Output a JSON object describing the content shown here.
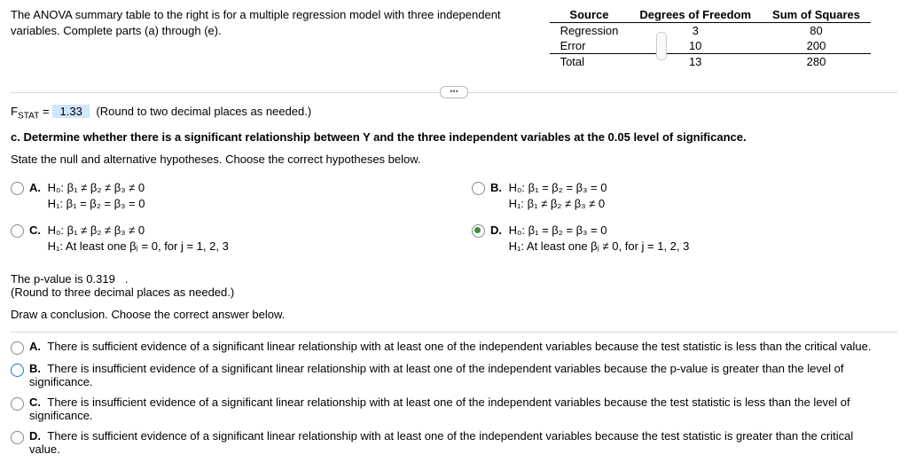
{
  "intro": "The ANOVA summary table to the right is for a multiple regression model with three independent variables. Complete parts (a) through (e).",
  "anova": {
    "headers": {
      "source": "Source",
      "df": "Degrees of Freedom",
      "ss": "Sum of Squares"
    },
    "rows": {
      "regression": {
        "label": "Regression",
        "df": "3",
        "ss": "80"
      },
      "error": {
        "label": "Error",
        "df": "10",
        "ss": "200"
      },
      "total": {
        "label": "Total",
        "df": "13",
        "ss": "280"
      }
    }
  },
  "fstat": {
    "prefix": "F",
    "sublabel": "STAT",
    "equals": " = ",
    "value": "1.33",
    "hint": "(Round to two decimal places as needed.)"
  },
  "partC": {
    "prompt": "c. Determine whether there is a significant relationship between Y and the three independent variables at the 0.05 level of significance.",
    "state": "State the null and alternative hypotheses. Choose the correct hypotheses below."
  },
  "hyp": {
    "A": {
      "lead": "A.",
      "h0": "H₀: β₁ ≠ β₂ ≠ β₃ ≠ 0",
      "h1": "H₁: β₁ = β₂ = β₃ = 0"
    },
    "B": {
      "lead": "B.",
      "h0": "H₀: β₁ = β₂ = β₃ = 0",
      "h1": "H₁: β₁ ≠ β₂ ≠ β₃ ≠ 0"
    },
    "C": {
      "lead": "C.",
      "h0": "H₀: β₁ ≠ β₂ ≠ β₃ ≠ 0",
      "h1": "H₁: At least one βⱼ = 0, for j = 1, 2, 3"
    },
    "D": {
      "lead": "D.",
      "h0": "H₀: β₁ = β₂ = β₃ = 0",
      "h1": "H₁: At least one βⱼ ≠ 0, for j = 1, 2, 3"
    }
  },
  "pval": {
    "prefix": "The p-value is ",
    "value": "0.319",
    "suffix": " .",
    "hint": "(Round to three decimal places as needed.)"
  },
  "conclPrompt": "Draw a conclusion. Choose the correct answer below.",
  "concl": {
    "A": {
      "lead": "A.",
      "text": "There is sufficient evidence of a significant linear relationship with at least one of the independent variables because the test statistic is less than the critical value."
    },
    "B": {
      "lead": "B.",
      "text": "There is insufficient evidence of a significant linear relationship with at least one of the independent variables because the p-value is greater than the level of significance."
    },
    "C": {
      "lead": "C.",
      "text": "There is insufficient evidence of a significant linear relationship with at least one of the independent variables because the test statistic is less than the level of significance."
    },
    "D": {
      "lead": "D.",
      "text": "There is sufficient evidence of a significant linear relationship with at least one of the independent variables because the test statistic is  greater than the critical value."
    }
  },
  "chart_data": {
    "type": "table",
    "title": "ANOVA summary",
    "columns": [
      "Source",
      "Degrees of Freedom",
      "Sum of Squares"
    ],
    "rows": [
      [
        "Regression",
        3,
        80
      ],
      [
        "Error",
        10,
        200
      ],
      [
        "Total",
        13,
        280
      ]
    ]
  }
}
